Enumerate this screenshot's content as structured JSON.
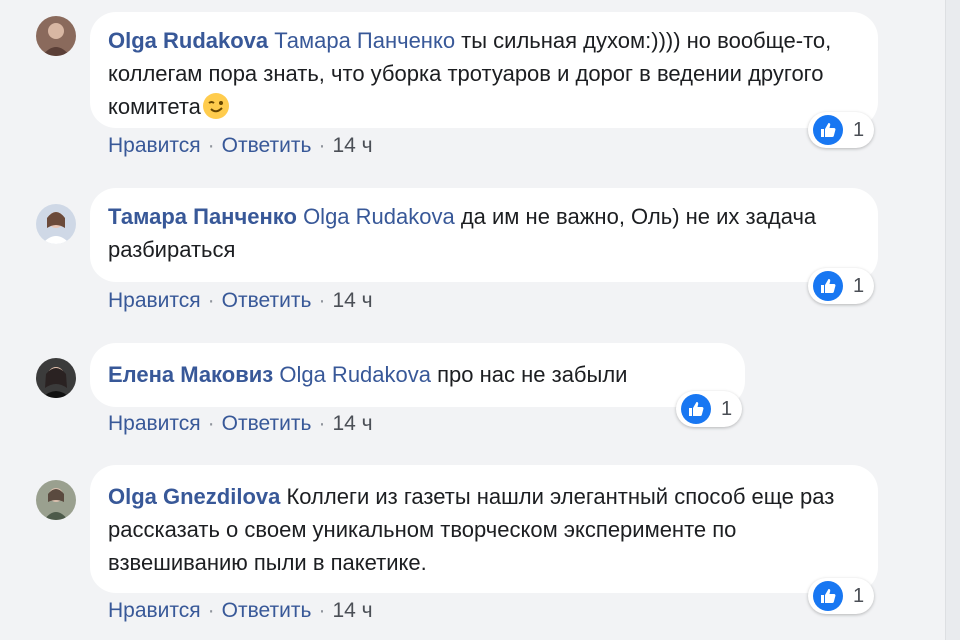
{
  "actions": {
    "like": "Нравится",
    "reply": "Ответить",
    "sep": "·"
  },
  "comments": [
    {
      "author": "Olga Rudakova",
      "mention": "Тамара Панченко",
      "text": " ты сильная духом:)))) но вообще-то, коллегам пора знать, что уборка тротуаров и дорог в ведении другого комитета",
      "emoji": "wink-emoji",
      "time": "14 ч",
      "likes": "1"
    },
    {
      "author": "Тамара Панченко",
      "mention": "Olga Rudakova",
      "text": " да им не важно, Оль) не их задача разбираться",
      "time": "14 ч",
      "likes": "1"
    },
    {
      "author": "Елена Маковиз",
      "mention": "Olga Rudakova",
      "text": " про нас не забыли",
      "time": "14 ч",
      "likes": "1"
    },
    {
      "author": "Olga Gnezdilova",
      "mention": "",
      "text": " Коллеги из газеты нашли элегантный способ еще раз рассказать о своем уникальном творческом эксперименте по взвешиванию пыли в пакетике.",
      "time": "14 ч",
      "likes": "1"
    }
  ]
}
